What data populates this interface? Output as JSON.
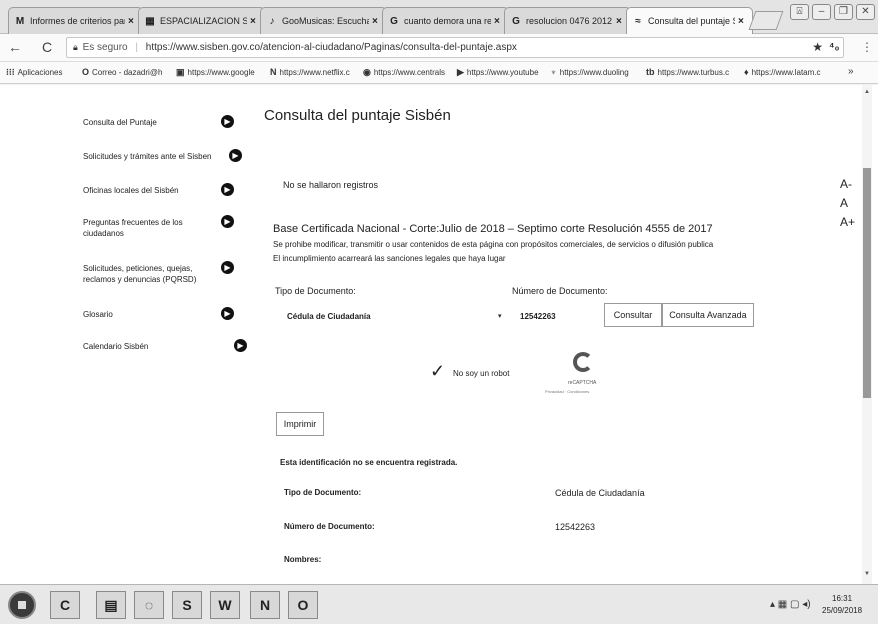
{
  "tabs": [
    {
      "icon": "M",
      "title": "Informes de criterios para",
      "active": false
    },
    {
      "icon": "▦",
      "title": "ESPACIALIZACION SANC",
      "active": false
    },
    {
      "icon": "♪",
      "title": "GooMusicas: Escuchar M",
      "active": false
    },
    {
      "icon": "G",
      "title": "cuanto demora una resp",
      "active": false
    },
    {
      "icon": "G",
      "title": "resolucion 0476 2012 - B.",
      "active": false
    },
    {
      "icon": "≈",
      "title": "Consulta del puntaje Sis",
      "active": true
    }
  ],
  "address": {
    "secure_label": "Es seguro",
    "url": "https://www.sisben.gov.co/atencion-al-ciudadano/Paginas/consulta-del-puntaje.aspx"
  },
  "bookmarks": [
    {
      "icon": "⁝⁝⁝",
      "label": "Aplicaciones"
    },
    {
      "icon": "O",
      "label": "Correo - dazadri@h"
    },
    {
      "icon": "▣",
      "label": "https://www.google"
    },
    {
      "icon": "N",
      "label": "https://www.netflix.c"
    },
    {
      "icon": "◉",
      "label": "https://www.centrals"
    },
    {
      "icon": "▶",
      "label": "https://www.youtube"
    },
    {
      "icon": "♆",
      "label": "https://www.duoling"
    },
    {
      "icon": "tb",
      "label": "https://www.turbus.c"
    },
    {
      "icon": "♦",
      "label": "https://www.latam.c"
    }
  ],
  "sidebar": {
    "items": [
      {
        "label": "Consulta del Puntaje"
      },
      {
        "label": "Solicitudes y trámites ante el Sisben"
      },
      {
        "label": "Oficinas locales del Sisbén"
      },
      {
        "label": "Preguntas frecuentes de los ciudadanos"
      },
      {
        "label": "Solicitudes, peticiones, quejas, reclamos y denuncias (PQRSD)"
      },
      {
        "label": "Glosario"
      },
      {
        "label": "Calendario Sisbén"
      }
    ]
  },
  "main": {
    "title": "Consulta del puntaje Sisbén",
    "no_records": "No se hallaron registros",
    "font_controls": [
      "A-",
      "A",
      "A+"
    ],
    "base_title": "Base Certificada Nacional - Corte:Julio de 2018 – Septimo corte Resolución 4555 de 2017",
    "notice_1": "Se prohibe modificar, transmitir o usar contenidos de esta página con propósitos comerciales, de servicios o difusión publica",
    "notice_2": "El incumplimiento acarreará las sanciones legales que haya lugar",
    "doc_type_label": "Tipo de Documento:",
    "doc_number_label": "Número de Documento:",
    "doc_type_value": "Cédula de Ciudadanía",
    "doc_number_value": "12542263",
    "consult_btn": "Consultar",
    "advanced_btn": "Consulta Avanzada",
    "robot_label": "No soy un robot",
    "recaptcha_label": "reCAPTCHA",
    "recaptcha_sub": "Privacidad · Condiciones",
    "print_btn": "Imprimir",
    "not_registered": "Esta identificación no se encuentra registrada.",
    "result_type_label": "Tipo de Documento:",
    "result_type_value": "Cédula de Ciudadanía",
    "result_number_label": "Número de Documento:",
    "result_number_value": "12542263",
    "names_label": "Nombres:"
  },
  "taskbar": {
    "apps": [
      "C",
      "▤",
      "◌",
      "S",
      "W",
      "N",
      "O"
    ],
    "time": "16:31",
    "date": "25/09/2018"
  }
}
